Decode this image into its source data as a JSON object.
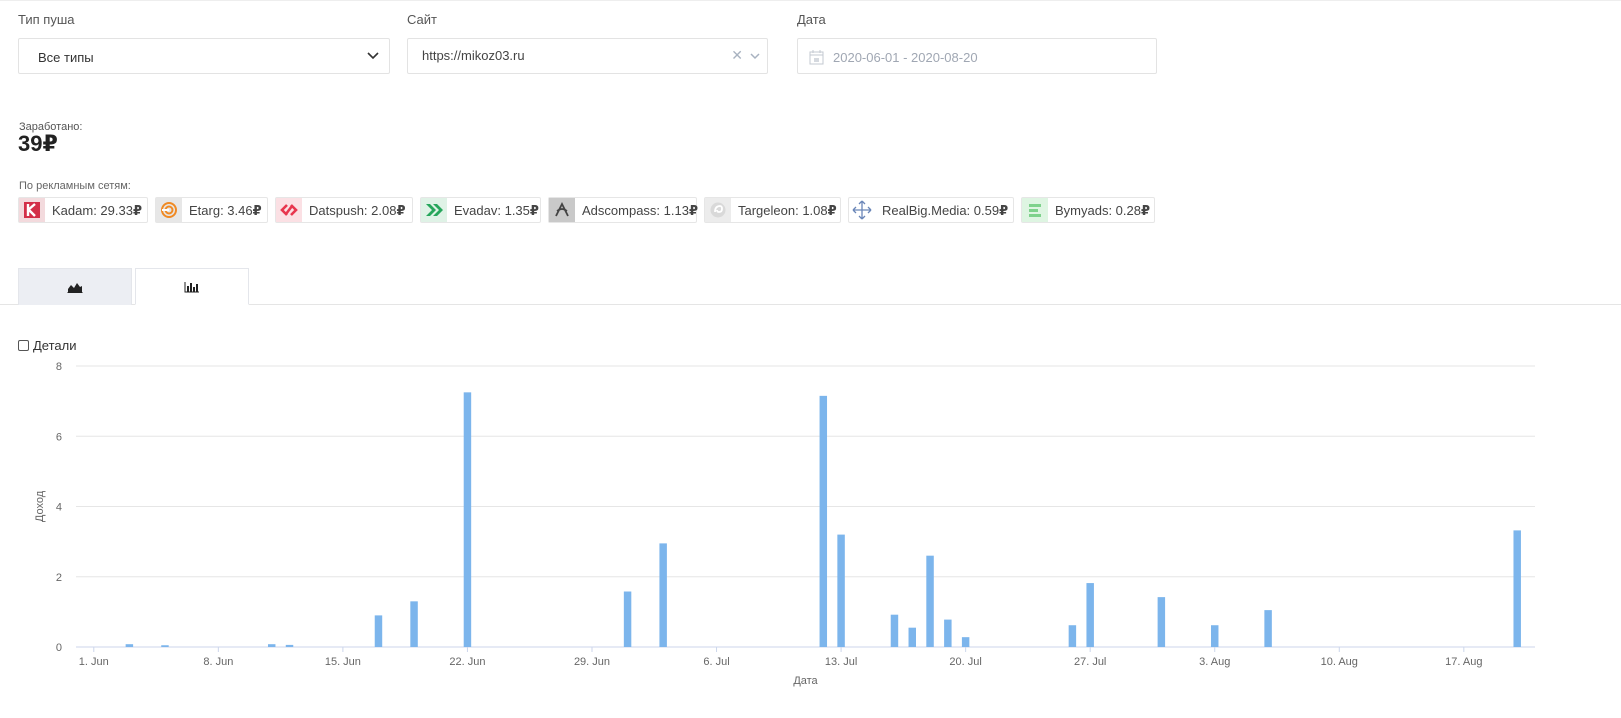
{
  "filters": {
    "push_type": {
      "label": "Тип пуша",
      "value": "Все типы"
    },
    "site": {
      "label": "Сайт",
      "value": "https://mikoz03.ru"
    },
    "date": {
      "label": "Дата",
      "value": "2020-06-01 - 2020-08-20"
    }
  },
  "earned": {
    "label": "Заработано:",
    "value": "39",
    "currency": "₽"
  },
  "networks": {
    "label": "По рекламным сетям:",
    "items": [
      {
        "name": "Kadam",
        "text": "Kadam: 29.33",
        "icon": "kadam-logo",
        "color": "#d32f48"
      },
      {
        "name": "Etarg",
        "text": "Etarg: 3.46",
        "icon": "etarg-logo",
        "color": "#f08a24"
      },
      {
        "name": "Datspush",
        "text": "Datspush: 2.08",
        "icon": "datspush-logo",
        "color": "#e8364e"
      },
      {
        "name": "Evadav",
        "text": "Evadav: 1.35",
        "icon": "evadav-logo",
        "color": "#26a65b"
      },
      {
        "name": "Adscompass",
        "text": "Adscompass: 1.13",
        "icon": "adscompass-logo",
        "color": "#555555"
      },
      {
        "name": "Targeleon",
        "text": "Targeleon: 1.08",
        "icon": "targeleon-logo",
        "color": "#b9b9b9"
      },
      {
        "name": "RealBig.Media",
        "text": "RealBig.Media: 0.59",
        "icon": "realbig-logo",
        "color": "#6a86b8"
      },
      {
        "name": "Bymyads",
        "text": "Bymyads: 0.28",
        "icon": "bymyads-logo",
        "color": "#7ed28c"
      }
    ]
  },
  "tabs": [
    {
      "name": "area-chart",
      "icon": "area-chart-icon"
    },
    {
      "name": "bar-chart",
      "icon": "bar-chart-icon",
      "active": true
    }
  ],
  "details": {
    "label": "Детали",
    "checked": false
  },
  "chart_data": {
    "type": "bar",
    "title": "",
    "xlabel": "Дата",
    "ylabel": "Доход",
    "ylim": [
      0,
      8
    ],
    "yticks": [
      0,
      2,
      4,
      6,
      8
    ],
    "xrange": [
      "2020-05-31",
      "2020-08-21"
    ],
    "xticks": [
      {
        "date": "2020-06-01",
        "label": "1. Jun"
      },
      {
        "date": "2020-06-08",
        "label": "8. Jun"
      },
      {
        "date": "2020-06-15",
        "label": "15. Jun"
      },
      {
        "date": "2020-06-22",
        "label": "22. Jun"
      },
      {
        "date": "2020-06-29",
        "label": "29. Jun"
      },
      {
        "date": "2020-07-06",
        "label": "6. Jul"
      },
      {
        "date": "2020-07-13",
        "label": "13. Jul"
      },
      {
        "date": "2020-07-20",
        "label": "20. Jul"
      },
      {
        "date": "2020-07-27",
        "label": "27. Jul"
      },
      {
        "date": "2020-08-03",
        "label": "3. Aug"
      },
      {
        "date": "2020-08-10",
        "label": "10. Aug"
      },
      {
        "date": "2020-08-17",
        "label": "17. Aug"
      }
    ],
    "grid": true,
    "bar_color": "#7cb5ec",
    "points": [
      {
        "date": "2020-06-03",
        "value": 0.08
      },
      {
        "date": "2020-06-05",
        "value": 0.05
      },
      {
        "date": "2020-06-11",
        "value": 0.08
      },
      {
        "date": "2020-06-12",
        "value": 0.06
      },
      {
        "date": "2020-06-17",
        "value": 0.9
      },
      {
        "date": "2020-06-19",
        "value": 1.3
      },
      {
        "date": "2020-06-22",
        "value": 7.25
      },
      {
        "date": "2020-07-01",
        "value": 1.58
      },
      {
        "date": "2020-07-03",
        "value": 2.95
      },
      {
        "date": "2020-07-12",
        "value": 7.15
      },
      {
        "date": "2020-07-13",
        "value": 3.2
      },
      {
        "date": "2020-07-16",
        "value": 0.92
      },
      {
        "date": "2020-07-17",
        "value": 0.55
      },
      {
        "date": "2020-07-18",
        "value": 2.6
      },
      {
        "date": "2020-07-19",
        "value": 0.78
      },
      {
        "date": "2020-07-20",
        "value": 0.28
      },
      {
        "date": "2020-07-26",
        "value": 0.62
      },
      {
        "date": "2020-07-27",
        "value": 1.82
      },
      {
        "date": "2020-07-31",
        "value": 1.42
      },
      {
        "date": "2020-08-03",
        "value": 0.62
      },
      {
        "date": "2020-08-06",
        "value": 1.05
      },
      {
        "date": "2020-08-20",
        "value": 3.32
      }
    ]
  }
}
